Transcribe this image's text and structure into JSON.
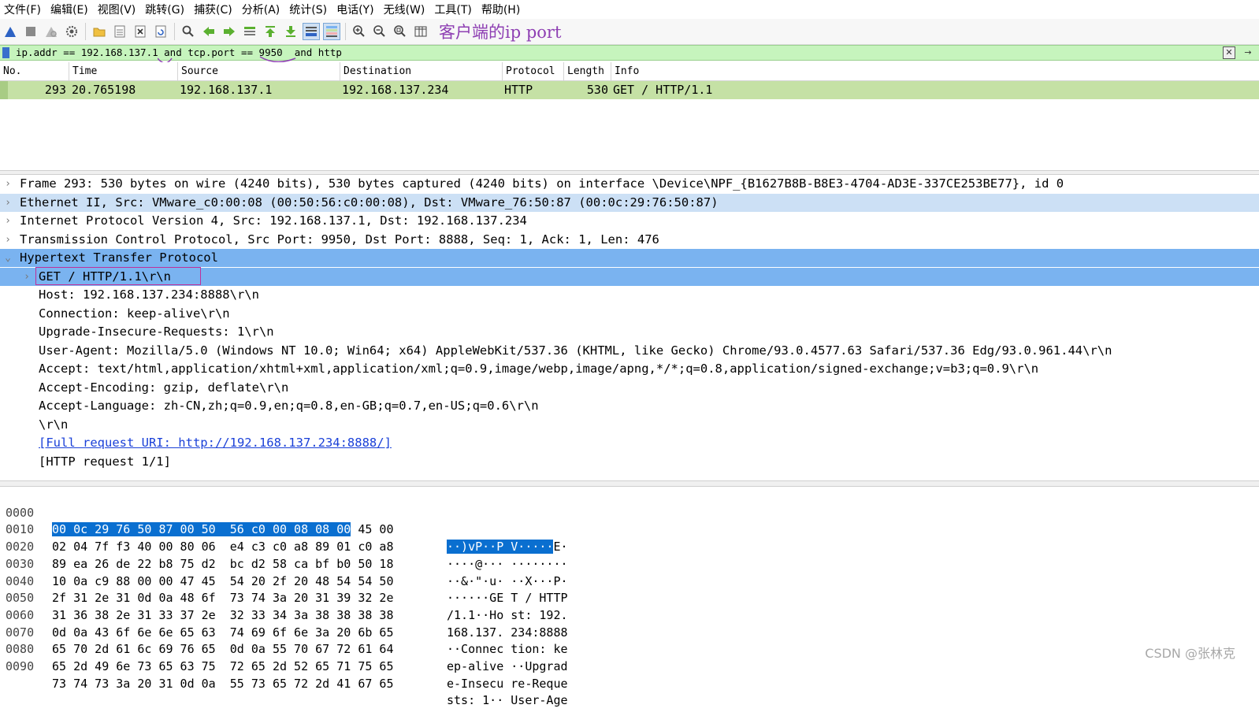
{
  "menu": [
    "文件(F)",
    "编辑(E)",
    "视图(V)",
    "跳转(G)",
    "捕获(C)",
    "分析(A)",
    "统计(S)",
    "电话(Y)",
    "无线(W)",
    "工具(T)",
    "帮助(H)"
  ],
  "toolbar": {
    "annotation": "客户端的ip port",
    "icons": [
      "shark-fin-start-icon",
      "stop-square-icon",
      "restart-fin-icon",
      "capture-options-gear-icon",
      "open-folder-icon",
      "save-file-icon",
      "close-file-icon",
      "reload-icon",
      "find-magnifier-icon",
      "go-back-arrow-icon",
      "go-forward-arrow-icon",
      "go-to-packet-icon",
      "go-first-packet-icon",
      "go-last-packet-icon",
      "auto-scroll-icon",
      "colorize-icon",
      "zoom-in-icon",
      "zoom-out-icon",
      "zoom-normal-icon",
      "resize-columns-icon"
    ]
  },
  "filter": {
    "text": "ip.addr == 192.168.137.1 and tcp.port == 9950  and http"
  },
  "packet_list": {
    "columns": [
      "No.",
      "Time",
      "Source",
      "Destination",
      "Protocol",
      "Length",
      "Info"
    ],
    "rows": [
      {
        "no": "293",
        "time": "20.765198",
        "source": "192.168.137.1",
        "destination": "192.168.137.234",
        "protocol": "HTTP",
        "length": "530",
        "info": "GET / HTTP/1.1"
      }
    ],
    "row_color": "#c5e1a5"
  },
  "details": [
    {
      "text": "Frame 293: 530 bytes on wire (4240 bits), 530 bytes captured (4240 bits) on interface \\Device\\NPF_{B1627B8B-B8E3-4704-AD3E-337CE253BE77}, id 0",
      "expander": "›"
    },
    {
      "text": "Ethernet II, Src: VMware_c0:00:08 (00:50:56:c0:00:08), Dst: VMware_76:50:87 (00:0c:29:76:50:87)",
      "expander": "›"
    },
    {
      "text": "Internet Protocol Version 4, Src: 192.168.137.1, Dst: 192.168.137.234",
      "expander": "›"
    },
    {
      "text": "Transmission Control Protocol, Src Port: 9950, Dst Port: 8888, Seq: 1, Ack: 1, Len: 476",
      "expander": "›"
    },
    {
      "text": "Hypertext Transfer Protocol",
      "expander": "⌄"
    },
    {
      "text": "GET / HTTP/1.1\\r\\n",
      "expander": "›"
    },
    {
      "text": "Host: 192.168.137.234:8888\\r\\n",
      "expander": ""
    },
    {
      "text": "Connection: keep-alive\\r\\n",
      "expander": ""
    },
    {
      "text": "Upgrade-Insecure-Requests: 1\\r\\n",
      "expander": ""
    },
    {
      "text": "User-Agent: Mozilla/5.0 (Windows NT 10.0; Win64; x64) AppleWebKit/537.36 (KHTML, like Gecko) Chrome/93.0.4577.63 Safari/537.36 Edg/93.0.961.44\\r\\n",
      "expander": ""
    },
    {
      "text": "Accept: text/html,application/xhtml+xml,application/xml;q=0.9,image/webp,image/apng,*/*;q=0.8,application/signed-exchange;v=b3;q=0.9\\r\\n",
      "expander": ""
    },
    {
      "text": "Accept-Encoding: gzip, deflate\\r\\n",
      "expander": ""
    },
    {
      "text": "Accept-Language: zh-CN,zh;q=0.9,en;q=0.8,en-GB;q=0.7,en-US;q=0.6\\r\\n",
      "expander": ""
    },
    {
      "text": "\\r\\n",
      "expander": ""
    },
    {
      "text": "[Full request URI: http://192.168.137.234:8888/]",
      "expander": ""
    },
    {
      "text": "[HTTP request 1/1]",
      "expander": ""
    }
  ],
  "hex": [
    {
      "offset": "0000",
      "hex_sel": "00 0c 29 76 50 87 00 50  56 c0 00 08 08 00",
      "hex_rest": " 45 00",
      "ascii_sel": "··)vP··P V·····",
      "ascii_rest": "E·"
    },
    {
      "offset": "0010",
      "hex_sel": "",
      "hex_rest": "02 04 7f f3 40 00 80 06  e4 c3 c0 a8 89 01 c0 a8",
      "ascii_sel": "",
      "ascii_rest": "····@··· ········"
    },
    {
      "offset": "0020",
      "hex_sel": "",
      "hex_rest": "89 ea 26 de 22 b8 75 d2  bc d2 58 ca bf b0 50 18",
      "ascii_sel": "",
      "ascii_rest": "··&·\"·u· ··X···P·"
    },
    {
      "offset": "0030",
      "hex_sel": "",
      "hex_rest": "10 0a c9 88 00 00 47 45  54 20 2f 20 48 54 54 50",
      "ascii_sel": "",
      "ascii_rest": "······GE T / HTTP"
    },
    {
      "offset": "0040",
      "hex_sel": "",
      "hex_rest": "2f 31 2e 31 0d 0a 48 6f  73 74 3a 20 31 39 32 2e",
      "ascii_sel": "",
      "ascii_rest": "/1.1··Ho st: 192."
    },
    {
      "offset": "0050",
      "hex_sel": "",
      "hex_rest": "31 36 38 2e 31 33 37 2e  32 33 34 3a 38 38 38 38",
      "ascii_sel": "",
      "ascii_rest": "168.137. 234:8888"
    },
    {
      "offset": "0060",
      "hex_sel": "",
      "hex_rest": "0d 0a 43 6f 6e 6e 65 63  74 69 6f 6e 3a 20 6b 65",
      "ascii_sel": "",
      "ascii_rest": "··Connec tion: ke"
    },
    {
      "offset": "0070",
      "hex_sel": "",
      "hex_rest": "65 70 2d 61 6c 69 76 65  0d 0a 55 70 67 72 61 64",
      "ascii_sel": "",
      "ascii_rest": "ep-alive ··Upgrad"
    },
    {
      "offset": "0080",
      "hex_sel": "",
      "hex_rest": "65 2d 49 6e 73 65 63 75  72 65 2d 52 65 71 75 65",
      "ascii_sel": "",
      "ascii_rest": "e-Insecu re-Reque"
    },
    {
      "offset": "0090",
      "hex_sel": "",
      "hex_rest": "73 74 73 3a 20 31 0d 0a  55 73 65 72 2d 41 67 65",
      "ascii_sel": "",
      "ascii_rest": "sts: 1·· User-Age"
    }
  ],
  "watermark": "CSDN @张林克"
}
